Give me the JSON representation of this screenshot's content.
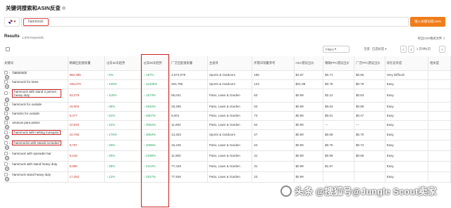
{
  "header": {
    "title": "关键词搜索和ASIN反查",
    "info_icon": "i"
  },
  "search": {
    "marketplace": "▾",
    "keyword": "hammock",
    "add_button": "输入关键词或ASIN"
  },
  "results": {
    "label": "Results",
    "count": "1,579 Keywords",
    "export": "导出CSV格式文件 ⇩"
  },
  "toolbar": {
    "filters": "Filters",
    "select_all": "全部",
    "clear": "已选标签 ▾",
    "page_prev": "<",
    "page_num": "1",
    "page_of": "1 页/共1页",
    "page_next": ">"
  },
  "columns": [
    "关键词",
    "精确匹配搜索量",
    "过去30天趋势",
    "过去90天趋势",
    "广泛匹配搜索量",
    "主类目",
    "所需日销量参考",
    "HSA建议出价",
    "精确PPC建议出价",
    "广泛PPC建议出价",
    "排名竞争度",
    "相关度"
  ],
  "rows": [
    {
      "kw": "hammock",
      "exact": "850,385",
      "t30": "9%",
      "t90": "187%",
      "broad": "2,672,078",
      "cat": "Sports & Outdoors",
      "units": "196",
      "hsa": "$4.87",
      "ppc_exact": "$0.71",
      "ppc_broad": "$0.86",
      "comp": "Very Difficult",
      "rel": ""
    },
    {
      "kw": "hammock for trees",
      "exact": "196,670",
      "t30": "138%",
      "t90": "11235%",
      "broad": "204,795",
      "cat": "Sports & Outdoors",
      "units": "123",
      "hsa": "$21.98",
      "ppc_exact": "$0.78",
      "ppc_broad": "$0.78",
      "comp": "Easy",
      "rel": ""
    },
    {
      "kw": "hammock with stand 2 person heavy duty",
      "exact": "53,279",
      "t30": "118%",
      "t90": "1573%",
      "broad": "56,041",
      "cat": "Patio, Lawn & Garden",
      "units": "63",
      "hsa": "$0.99",
      "ppc_exact": "$2.12",
      "ppc_broad": "$0.83",
      "comp": "Easy",
      "rel": ""
    },
    {
      "kw": "hammock for outside",
      "exact": "19,003",
      "t30": "46%",
      "t90": "4940%",
      "broad": "25,286",
      "cat": "Patio, Lawn & Garden",
      "units": "63",
      "hsa": "$0.99",
      "ppc_exact": "$0.63",
      "ppc_broad": "$0.89",
      "comp": "Easy",
      "rel": ""
    },
    {
      "kw": "hamicks for outside",
      "exact": "8,477",
      "t30": "81%",
      "t90": "3807%",
      "broad": "9,001",
      "cat": "Patio, Lawn & Garden",
      "units": "73",
      "hsa": "$0.99",
      "ppc_exact": "$0.61",
      "ppc_broad": "$0.47",
      "comp": "Easy",
      "rel": ""
    },
    {
      "kw": "amacas para patios",
      "exact": "10,940",
      "t30": "24%",
      "t90": "2052%",
      "broad": "11,694",
      "cat": "Patio, Lawn & Garden",
      "units": "64",
      "hsa": "$0.99",
      "ppc_exact": "---",
      "ppc_broad": "---",
      "comp": "Easy",
      "rel": ""
    },
    {
      "kw": "hammock with netting mosquito",
      "exact": "10,760",
      "t30": "176%",
      "t90": "3053%",
      "broad": "13,263",
      "cat": "Sports & Outdoors",
      "units": "27",
      "hsa": "$0.89",
      "ppc_exact": "$0.68",
      "ppc_broad": "$0.70",
      "comp": "Easy",
      "rel": ""
    },
    {
      "kw": "hammocks with stands included",
      "exact": "9,707",
      "t30": "20%",
      "t90": "2085%",
      "broad": "15,246",
      "cat": "Patio, Lawn & Garden",
      "units": "63",
      "hsa": "$0.99",
      "ppc_exact": "$0.75",
      "ppc_broad": "$0.74",
      "comp": "Easy",
      "rel": ""
    },
    {
      "kw": "hammock with spreader bar",
      "exact": "9,415",
      "t30": "29%",
      "t90": "2336%",
      "broad": "11,960",
      "cat": "Patio, Lawn & Garden",
      "units": "31",
      "hsa": "$0.99",
      "ppc_exact": "$0.99",
      "ppc_broad": "$0.96",
      "comp": "Easy",
      "rel": ""
    },
    {
      "kw": "hammock with stand heavy duty",
      "exact": "8,895",
      "t30": "28%",
      "t90": "2113%",
      "broad": "77,428",
      "cat": "Patio, Lawn & Garden",
      "units": "31",
      "hsa": "$0.99",
      "ppc_exact": "$1.97",
      "ppc_broad": "",
      "comp": "Easy",
      "rel": ""
    },
    {
      "kw": "hammock stand heavy duty",
      "exact": "17,352",
      "t30": "12%",
      "t90": "2527%",
      "broad": "77,926",
      "cat": "Patio, Lawn & Garden",
      "units": "23",
      "hsa": "$0.99",
      "ppc_exact": "",
      "ppc_broad": "",
      "comp": "Easy",
      "rel": ""
    }
  ],
  "watermark": "头条 @搜狐号@Jungle Scout卖家"
}
